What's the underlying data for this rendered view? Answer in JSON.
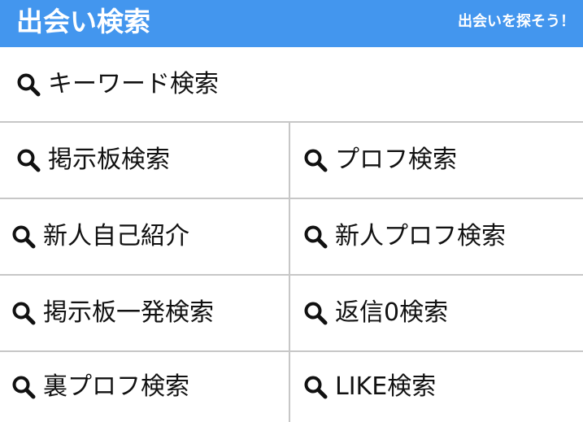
{
  "header": {
    "title": "出会い検索",
    "tagline": "出会いを探そう！",
    "background_color": "#4396ee"
  },
  "search_items": {
    "keyword": {
      "label": "キーワード検索",
      "icon": "search-icon"
    },
    "board": {
      "label": "掲示板検索",
      "icon": "search-icon"
    },
    "profile": {
      "label": "プロフ検索",
      "icon": "search-icon"
    },
    "newcomer_intro": {
      "label": "新人自己紹介",
      "icon": "search-icon"
    },
    "newcomer_profile": {
      "label": "新人プロフ検索",
      "icon": "search-icon"
    },
    "board_single": {
      "label": "掲示板一発検索",
      "icon": "search-icon"
    },
    "zero_replies": {
      "label": "返信0検索",
      "icon": "search-icon"
    },
    "back_profile": {
      "label": "裏プロフ検索",
      "icon": "search-icon"
    },
    "like": {
      "label": "LIKE検索",
      "icon": "search-icon"
    }
  }
}
